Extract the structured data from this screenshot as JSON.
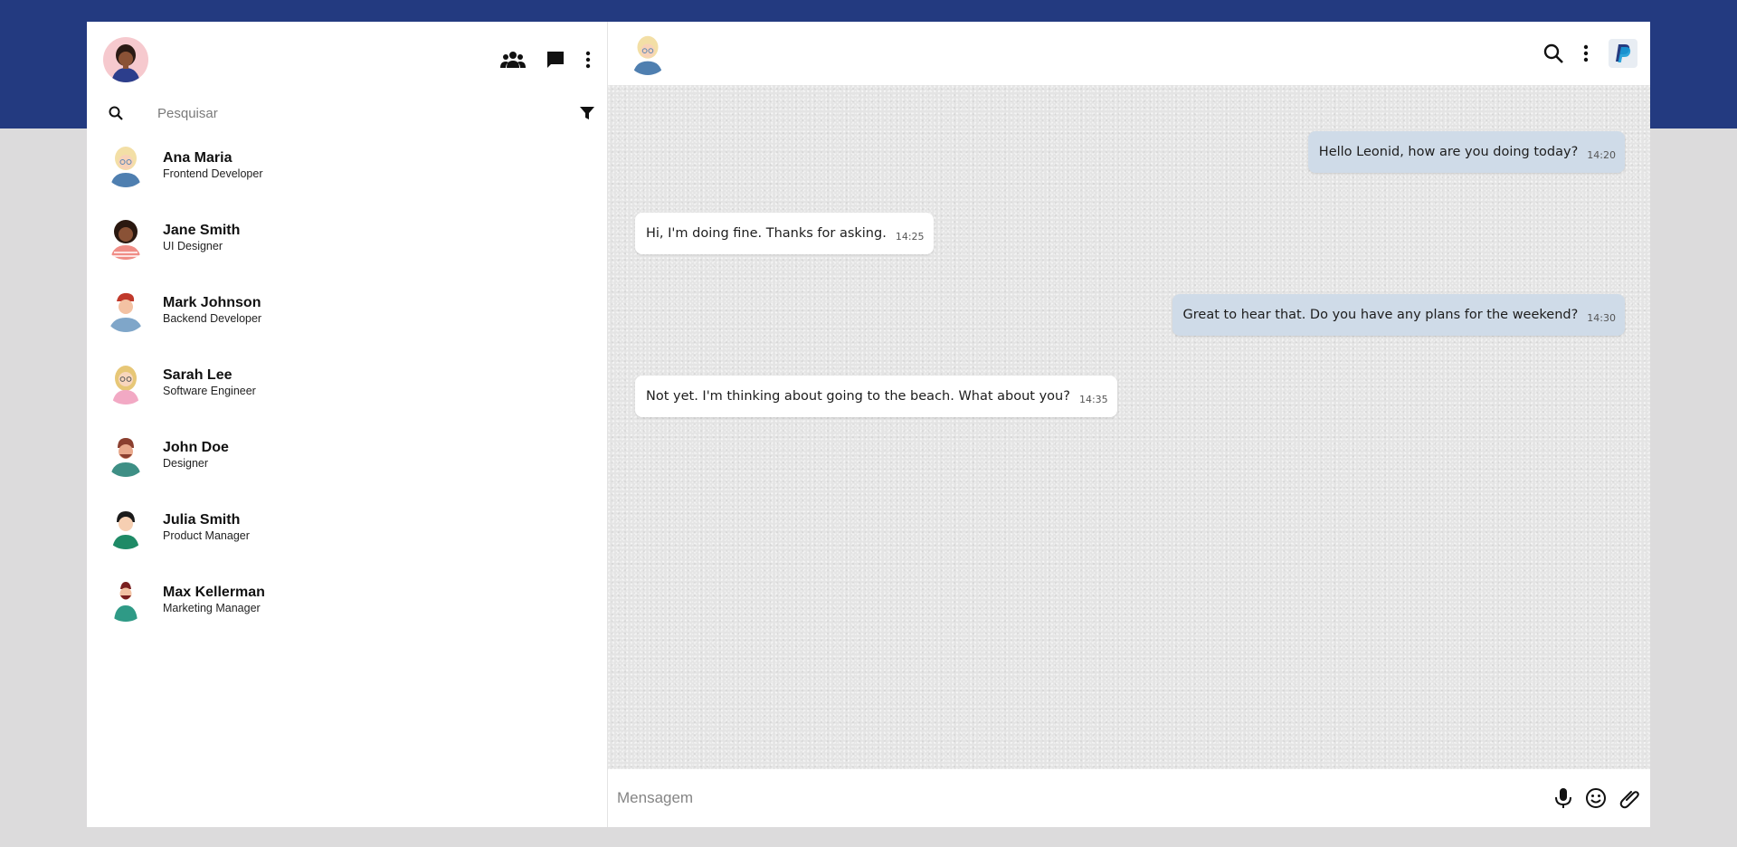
{
  "search": {
    "placeholder": "Pesquisar"
  },
  "contacts": [
    {
      "name": "Ana Maria",
      "role": "Frontend Developer"
    },
    {
      "name": "Jane Smith",
      "role": "UI Designer"
    },
    {
      "name": "Mark Johnson",
      "role": "Backend Developer"
    },
    {
      "name": "Sarah Lee",
      "role": "Software Engineer"
    },
    {
      "name": "John Doe",
      "role": "Designer"
    },
    {
      "name": "Julia Smith",
      "role": "Product Manager"
    },
    {
      "name": "Max Kellerman",
      "role": "Marketing Manager"
    }
  ],
  "messages": [
    {
      "direction": "out",
      "text": "Hello Leonid, how are you doing today?",
      "time": "14:20"
    },
    {
      "direction": "in",
      "text": "Hi, I'm doing fine. Thanks for asking.",
      "time": "14:25"
    },
    {
      "direction": "out",
      "text": "Great to hear that. Do you have any plans for the weekend?",
      "time": "14:30"
    },
    {
      "direction": "in",
      "text": "Not yet. I'm thinking about going to the beach. What about you?",
      "time": "14:35"
    }
  ],
  "composer": {
    "placeholder": "Mensagem"
  },
  "icons": {
    "sidebar": [
      "groups-icon",
      "chat-bubble-icon",
      "more-vert-icon"
    ],
    "search": "search-icon",
    "filter": "filter-icon",
    "chat_header": [
      "search-icon",
      "more-vert-icon",
      "paypal-logo-icon"
    ],
    "composer": [
      "mic-icon",
      "emoji-icon",
      "attach-icon"
    ]
  },
  "colors": {
    "top_band": "#233a80",
    "outgoing_bubble": "#cfdbe8",
    "incoming_bubble": "#ffffff",
    "page_background": "#dcdbdc"
  }
}
